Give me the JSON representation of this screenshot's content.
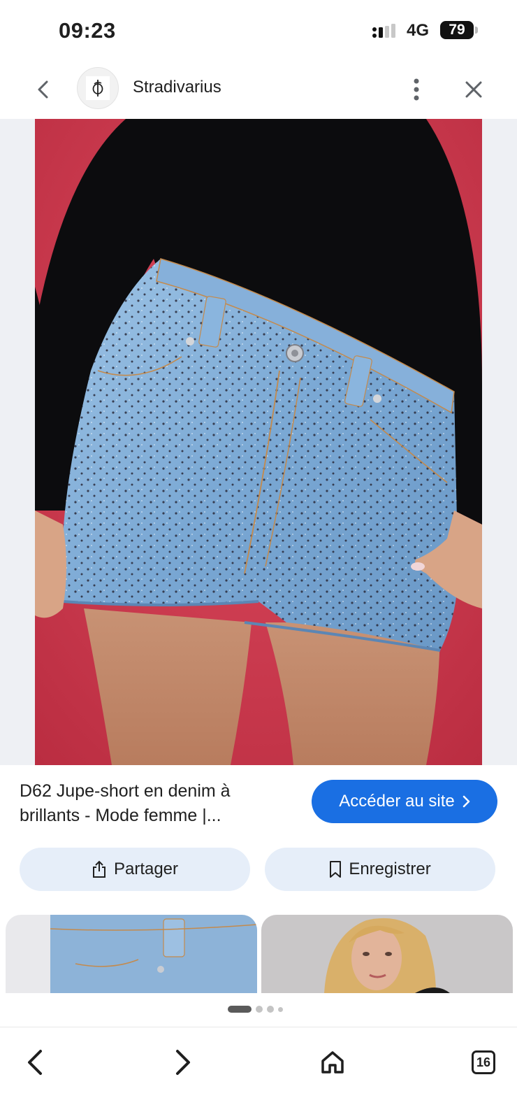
{
  "status_bar": {
    "time": "09:23",
    "network": "4G",
    "battery": "79"
  },
  "header": {
    "site_name": "Stradivarius",
    "icons": {
      "back": "chevron-left-icon",
      "logo": "stradivarius-logo-icon",
      "more": "more-vert-icon",
      "close": "close-icon"
    }
  },
  "product": {
    "image_description_icon": "product-photo",
    "title": "D62 Jupe-short en denim à brillants - Mode femme |...",
    "visit_button": "Accéder au site",
    "share_button": "Partager",
    "save_button": "Enregistrer"
  },
  "pager": {
    "pages": 4,
    "active_page": 1
  },
  "bottom_nav": {
    "tabs_count": "16",
    "icons": [
      "chevron-left-icon",
      "chevron-right-icon",
      "home-icon",
      "tabs-icon"
    ]
  },
  "colors": {
    "accent": "#1a6fe3",
    "action_bg": "#e6eef9",
    "image_bg": "#eef0f4",
    "photo_backdrop": "#d13a4e"
  }
}
